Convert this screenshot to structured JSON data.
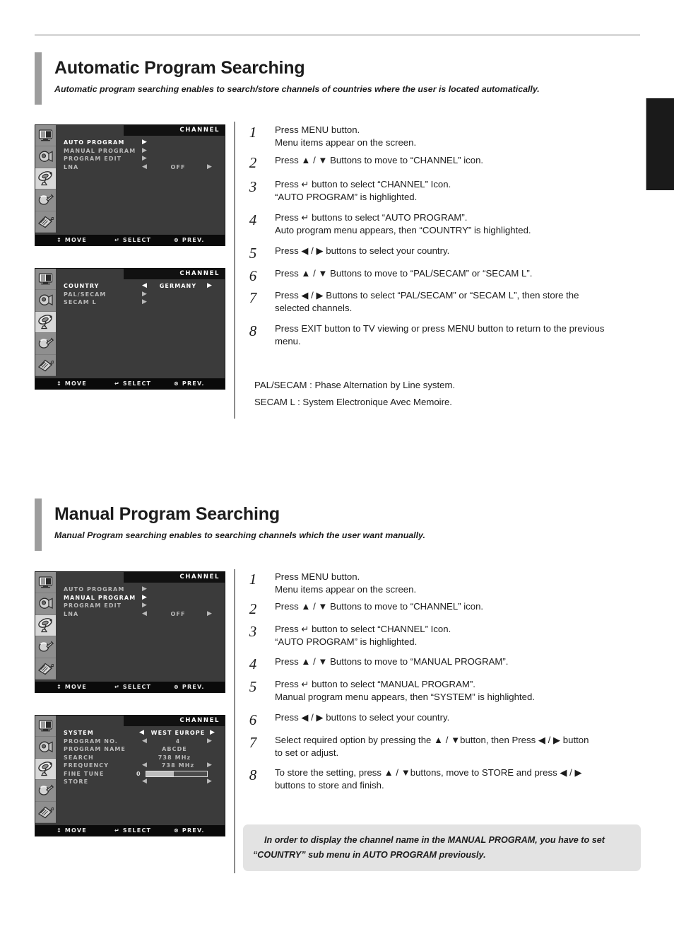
{
  "page": {
    "edge_tab_label": ""
  },
  "sections": [
    {
      "id": "auto",
      "title": "Automatic Program Searching",
      "subtitle": "Automatic program searching enables to search/store channels of countries where the user is located automatically.",
      "osd": [
        {
          "title": "CHANNEL",
          "selected_icon_index": 2,
          "rows": [
            {
              "label": "AUTO PROGRAM",
              "highlight": true,
              "left_arrow": "",
              "value": "",
              "right_arrow": "▶",
              "arrow_inline": true
            },
            {
              "label": "MANUAL PROGRAM",
              "highlight": false,
              "left_arrow": "",
              "value": "",
              "right_arrow": "▶",
              "arrow_inline": true
            },
            {
              "label": "PROGRAM EDIT",
              "highlight": false,
              "left_arrow": "",
              "value": "",
              "right_arrow": "▶",
              "arrow_inline": true
            },
            {
              "label": "LNA",
              "highlight": false,
              "left_arrow": "◀",
              "value": "OFF",
              "right_arrow": "▶"
            }
          ],
          "footer": {
            "move": "↕ MOVE",
            "select": "↵ SELECT",
            "prev": "⊗ PREV."
          }
        },
        {
          "title": "CHANNEL",
          "selected_icon_index": 2,
          "rows": [
            {
              "label": "COUNTRY",
              "highlight": true,
              "left_arrow": "◀",
              "value": "GERMANY",
              "right_arrow": "▶"
            },
            {
              "label": "PAL/SECAM",
              "highlight": false,
              "left_arrow": "",
              "value": "",
              "right_arrow": "▶",
              "arrow_inline": true
            },
            {
              "label": "SECAM L",
              "highlight": false,
              "left_arrow": "",
              "value": "",
              "right_arrow": "▶",
              "arrow_inline": true
            }
          ],
          "footer": {
            "move": "↕ MOVE",
            "select": "↵ SELECT",
            "prev": "⊗ PREV."
          }
        }
      ],
      "steps": [
        {
          "num": "1",
          "lines": [
            "Press MENU button.",
            "Menu items appear on the screen."
          ]
        },
        {
          "num": "2",
          "lines": [
            "Press ▲ / ▼ Buttons to move to “CHANNEL” icon."
          ]
        },
        {
          "num": "3",
          "lines": [
            "Press ↵ button to select “CHANNEL” Icon.",
            "“AUTO PROGRAM” is highlighted."
          ]
        },
        {
          "num": "4",
          "lines": [
            "Press ↵ buttons to select  “AUTO PROGRAM”.",
            "Auto program menu appears, then “COUNTRY” is highlighted."
          ]
        },
        {
          "num": "5",
          "lines": [
            "Press ◀ / ▶ buttons to select your country."
          ]
        },
        {
          "num": "6",
          "lines": [
            "Press ▲ / ▼ Buttons to move to “PAL/SECAM” or “SECAM L”."
          ]
        },
        {
          "num": "7",
          "lines": [
            "Press ◀ / ▶ Buttons to select “PAL/SECAM” or “SECAM L”, then store the",
            "selected channels."
          ]
        },
        {
          "num": "8",
          "lines": [
            "Press EXIT button to TV viewing or press MENU button to return to the previous",
            "menu."
          ]
        }
      ],
      "definitions": [
        "PAL/SECAM : Phase Alternation by Line system.",
        "SECAM L : System Electronique Avec Memoire."
      ]
    },
    {
      "id": "manual",
      "title": "Manual Program Searching",
      "subtitle": "Manual Program searching enables to searching channels which the user want manually.",
      "osd": [
        {
          "title": "CHANNEL",
          "selected_icon_index": 2,
          "rows": [
            {
              "label": "AUTO PROGRAM",
              "highlight": false,
              "left_arrow": "",
              "value": "",
              "right_arrow": "▶",
              "arrow_inline": true
            },
            {
              "label": "MANUAL PROGRAM",
              "highlight": true,
              "left_arrow": "",
              "value": "",
              "right_arrow": "▶",
              "arrow_inline": true
            },
            {
              "label": "PROGRAM EDIT",
              "highlight": false,
              "left_arrow": "",
              "value": "",
              "right_arrow": "▶",
              "arrow_inline": true
            },
            {
              "label": "LNA",
              "highlight": false,
              "left_arrow": "◀",
              "value": "OFF",
              "right_arrow": "▶"
            }
          ],
          "footer": {
            "move": "↕ MOVE",
            "select": "↵ SELECT",
            "prev": "⊗ PREV."
          }
        },
        {
          "title": "CHANNEL",
          "selected_icon_index": 2,
          "rows": [
            {
              "label": "SYSTEM",
              "highlight": true,
              "left_arrow": "◀",
              "value": "WEST EUROPE",
              "right_arrow": "▶",
              "wide": true
            },
            {
              "label": "PROGRAM NO.",
              "highlight": false,
              "left_arrow": "◀",
              "value": "4",
              "right_arrow": "▶"
            },
            {
              "label": "PROGRAM NAME",
              "highlight": false,
              "left_arrow": "",
              "value": "ABCDE",
              "right_arrow": "",
              "center_only": true
            },
            {
              "label": "SEARCH",
              "highlight": false,
              "left_arrow": "",
              "value": "738 MHz",
              "right_arrow": "",
              "center_only": true
            },
            {
              "label": "FREQUENCY",
              "highlight": false,
              "left_arrow": "◀",
              "value": "738 MHz",
              "right_arrow": "▶"
            },
            {
              "label": "FINE TUNE",
              "highlight": false,
              "slider": true,
              "slider_value": "0",
              "slider_percent": 45
            },
            {
              "label": "STORE",
              "highlight": false,
              "left_arrow": "◀",
              "value": "",
              "right_arrow": "▶"
            }
          ],
          "footer": {
            "move": "↕ MOVE",
            "select": "↵ SELECT",
            "prev": "⊗ PREV."
          }
        }
      ],
      "steps": [
        {
          "num": "1",
          "lines": [
            "Press MENU button.",
            "Menu items appear on the screen."
          ]
        },
        {
          "num": "2",
          "lines": [
            "Press ▲ / ▼ Buttons to move to “CHANNEL” icon."
          ]
        },
        {
          "num": "3",
          "lines": [
            "Press ↵ button to select “CHANNEL” Icon.",
            "“AUTO PROGRAM” is highlighted."
          ]
        },
        {
          "num": "4",
          "lines": [
            "Press ▲ / ▼ Buttons to move to “MANUAL PROGRAM”."
          ]
        },
        {
          "num": "5",
          "lines": [
            "Press ↵ button to select “MANUAL PROGRAM”.",
            "Manual program menu appears, then “SYSTEM” is highlighted."
          ]
        },
        {
          "num": "6",
          "lines": [
            "Press ◀ / ▶ buttons to select your country."
          ]
        },
        {
          "num": "7",
          "lines": [
            "Select required option by pressing the ▲ / ▼button, then Press ◀ / ▶ button",
            "to set or adjust."
          ]
        },
        {
          "num": "8",
          "lines": [
            "To store the setting, press ▲ / ▼buttons, move to STORE and press ◀ / ▶",
            "buttons to store and finish."
          ]
        }
      ],
      "note": {
        "line1": "In order to display the channel name in the MANUAL PROGRAM, you have to set",
        "line2": "“COUNTRY” sub menu in AUTO PROGRAM previously."
      }
    }
  ],
  "osd_icons": [
    "picture-tv-icon",
    "sound-speaker-icon",
    "channel-satellite-icon",
    "setup-wrench-icon",
    "function-remote-icon"
  ],
  "colors": {
    "accent_bar": "#9d9d9d",
    "osd_background": "#3b3b3b",
    "osd_sidebar": "#8f8f8f",
    "osd_titlebar": "#111111",
    "note_background": "#e3e3e3",
    "text": "#1c1c1c"
  }
}
